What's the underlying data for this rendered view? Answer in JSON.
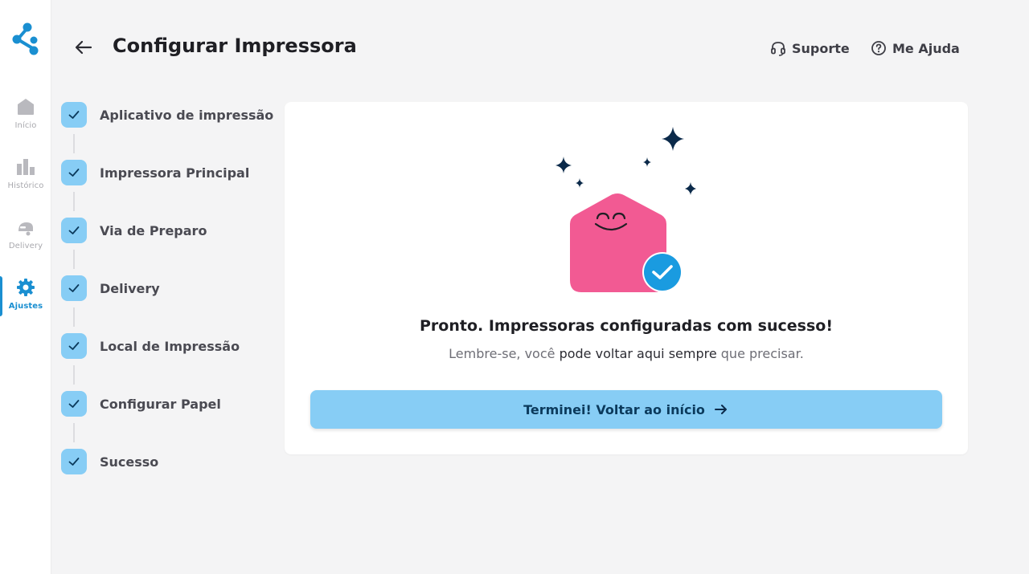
{
  "colors": {
    "accent": "#1a8fd1",
    "step_check_bg": "#87cdf5",
    "button_bg": "#87cdf5",
    "envelope": "#f25a93",
    "sparkle": "#0b2a4a"
  },
  "sidebar": {
    "items": [
      {
        "label": "Início",
        "icon": "home-icon",
        "active": false
      },
      {
        "label": "Histórico",
        "icon": "bar-chart-icon",
        "active": false
      },
      {
        "label": "Delivery",
        "icon": "scooter-icon",
        "active": false
      },
      {
        "label": "Ajustes",
        "icon": "gear-icon",
        "active": true
      }
    ]
  },
  "header": {
    "title": "Configurar Impressora",
    "support_label": "Suporte",
    "help_label": "Me Ajuda"
  },
  "stepper": {
    "steps": [
      {
        "label": "Aplicativo de impressão",
        "done": true
      },
      {
        "label": "Impressora Principal",
        "done": true
      },
      {
        "label": "Via de Preparo",
        "done": true
      },
      {
        "label": "Delivery",
        "done": true
      },
      {
        "label": "Local de Impressão",
        "done": true
      },
      {
        "label": "Configurar Papel",
        "done": true
      },
      {
        "label": "Sucesso",
        "done": true
      }
    ]
  },
  "success": {
    "title": "Pronto. Impressoras configuradas com sucesso!",
    "subtitle_parts": [
      "Lembre-se, você ",
      "pode voltar aqui sempre",
      " que precisar."
    ],
    "button_label": "Terminei! Voltar ao início"
  }
}
